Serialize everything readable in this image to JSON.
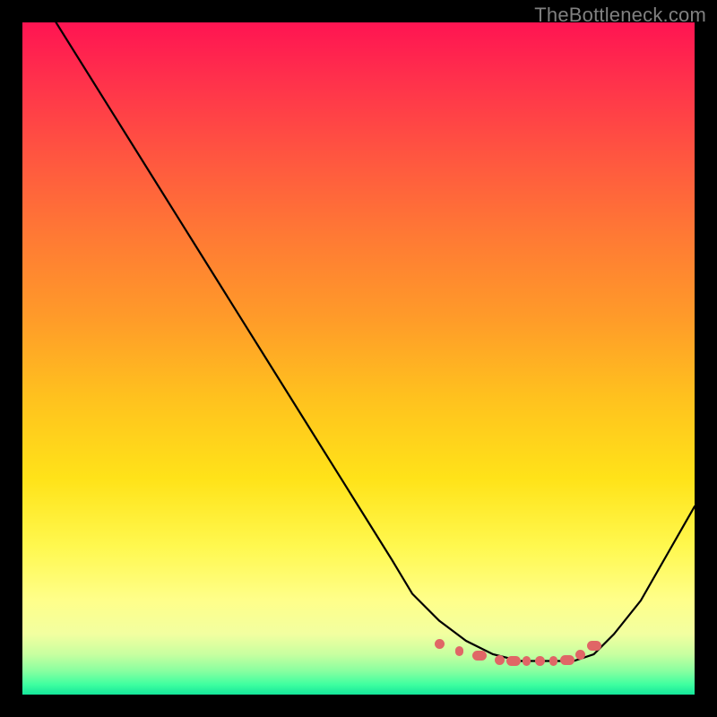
{
  "watermark": "TheBottleneck.com",
  "colors": {
    "background": "#000000",
    "marker": "#e06666",
    "curve": "#000000"
  },
  "chart_data": {
    "type": "line",
    "title": "",
    "xlabel": "",
    "ylabel": "",
    "xlim": [
      0,
      100
    ],
    "ylim": [
      0,
      100
    ],
    "grid": false,
    "note": "Values are estimated from the raster; y is read as vertical position where 0 = bottom (green) and 100 = top (red). The curve is a V-shaped bottleneck profile descending from top-left to a flat minimum around x≈70–82, then rising toward the right edge.",
    "series": [
      {
        "name": "bottleneck-curve",
        "x": [
          5,
          10,
          15,
          20,
          25,
          30,
          35,
          40,
          45,
          50,
          55,
          58,
          62,
          66,
          70,
          74,
          78,
          82,
          85,
          88,
          92,
          96,
          100
        ],
        "y": [
          100,
          92,
          84,
          76,
          68,
          60,
          52,
          44,
          36,
          28,
          20,
          15,
          11,
          8,
          6,
          5,
          5,
          5,
          6,
          9,
          14,
          21,
          28
        ]
      },
      {
        "name": "optimal-markers",
        "x": [
          62,
          65,
          68,
          71,
          73,
          75,
          77,
          79,
          81,
          83,
          85
        ],
        "y": [
          7.5,
          6.5,
          5.8,
          5.2,
          5.0,
          5.0,
          5.0,
          5.0,
          5.2,
          6.0,
          7.3
        ]
      }
    ],
    "gradient_stops": [
      {
        "pos": 0.0,
        "color": "#ff1452"
      },
      {
        "pos": 0.5,
        "color": "#ffb020"
      },
      {
        "pos": 0.82,
        "color": "#ffff60"
      },
      {
        "pos": 1.0,
        "color": "#14e69a"
      }
    ]
  }
}
